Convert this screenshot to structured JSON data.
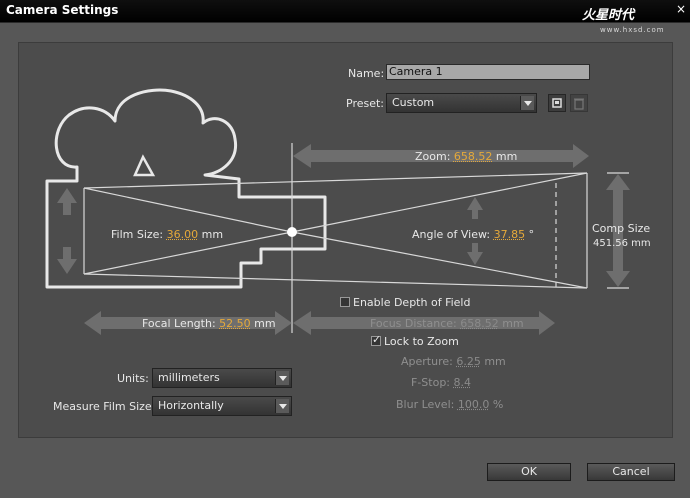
{
  "window": {
    "title": "Camera Settings",
    "close_glyph": "×",
    "logo_text": "火星时代",
    "logo_url": "www.hxsd.com"
  },
  "name": {
    "label": "Name:",
    "value": "Camera 1"
  },
  "preset": {
    "label": "Preset:",
    "value": "Custom"
  },
  "diagram": {
    "zoom_label": "Zoom:",
    "zoom_value": "658.52",
    "zoom_unit": "mm",
    "film_size_label": "Film Size:",
    "film_size_value": "36.00",
    "film_size_unit": "mm",
    "angle_label": "Angle of View:",
    "angle_value": "37.85",
    "angle_unit": "°",
    "comp_size_label": "Comp Size",
    "comp_size_value": "451.56 mm",
    "focal_label": "Focal Length:",
    "focal_value": "52.50",
    "focal_unit": "mm",
    "focus_label": "Focus Distance:",
    "focus_value": "658.52",
    "focus_unit": "mm"
  },
  "depth": {
    "enable_label": "Enable Depth of Field",
    "enable_checked": false,
    "lock_label": "Lock to Zoom",
    "lock_checked": true,
    "aperture_label": "Aperture:",
    "aperture_value": "6.25",
    "aperture_unit": "mm",
    "fstop_label": "F-Stop:",
    "fstop_value": "8.4",
    "blur_label": "Blur Level:",
    "blur_value": "100.0",
    "blur_unit": "%"
  },
  "units": {
    "label": "Units:",
    "value": "millimeters"
  },
  "measure": {
    "label": "Measure Film Size:",
    "value": "Horizontally"
  },
  "buttons": {
    "ok": "OK",
    "cancel": "Cancel"
  },
  "colors": {
    "accent_value": "#e5a93a",
    "panel": "#4c4c4c",
    "dialog": "#575757"
  }
}
